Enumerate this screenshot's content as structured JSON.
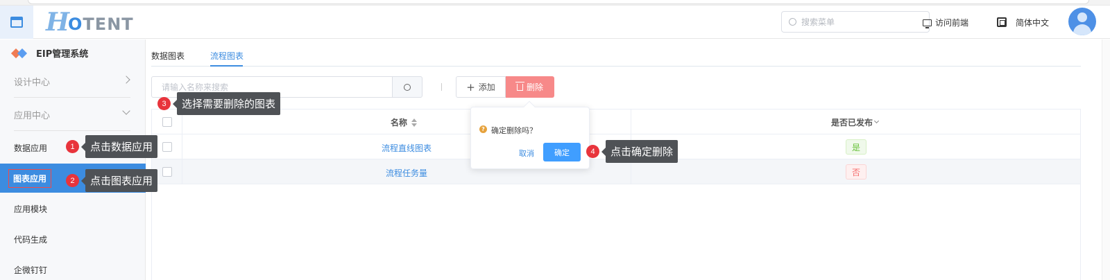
{
  "header": {
    "logo_h": "H",
    "logo_o": "O",
    "logo_rest": "TENT",
    "search_placeholder": "搜索菜单",
    "visit_frontend": "访问前端",
    "language": "简体中文"
  },
  "sidebar": {
    "system_title": "EIP管理系统",
    "items": [
      {
        "label": "设计中心"
      },
      {
        "label": "应用中心"
      },
      {
        "label": "数据应用"
      },
      {
        "label": "图表应用"
      },
      {
        "label": "应用模块"
      },
      {
        "label": "代码生成"
      },
      {
        "label": "企微钉钉"
      }
    ]
  },
  "tabs": [
    {
      "label": "数据图表"
    },
    {
      "label": "流程图表"
    }
  ],
  "toolbar": {
    "search_placeholder": "请输入名称来搜索",
    "add_label": "添加",
    "delete_label": "删除"
  },
  "table": {
    "columns": [
      "名称",
      "是否已发布"
    ],
    "rows": [
      {
        "name": "流程直线图表",
        "published": "是"
      },
      {
        "name": "流程任务量",
        "published": "否"
      }
    ]
  },
  "popconfirm": {
    "question": "确定删除吗？",
    "cancel": "取消",
    "confirm": "确定"
  },
  "annotations": [
    {
      "num": "1",
      "text": "点击数据应用"
    },
    {
      "num": "2",
      "text": "点击图表应用"
    },
    {
      "num": "3",
      "text": "选择需要删除的图表"
    },
    {
      "num": "4",
      "text": "点击确定删除"
    }
  ],
  "colors": {
    "primary": "#3c8ce0",
    "danger": "#f78989",
    "annotation_badge": "#e8343c",
    "callout_bg": "#4f5256"
  }
}
